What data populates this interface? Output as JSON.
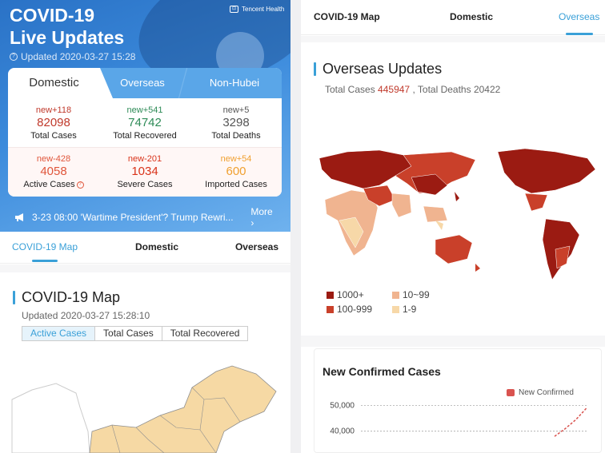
{
  "left": {
    "hero": {
      "title_line1": "COVID-19",
      "title_line2": "Live Updates",
      "brand": "Tencent Health",
      "updated": "Updated 2020-03-27 15:28"
    },
    "card": {
      "tabs": [
        "Domestic",
        "Overseas",
        "Non-Hubei"
      ],
      "stats": [
        {
          "new": "new+118",
          "value": "82098",
          "label": "Total Cases",
          "color": "#c0392b"
        },
        {
          "new": "new+541",
          "value": "74742",
          "label": "Total Recovered",
          "color": "#2e8b57"
        },
        {
          "new": "new+5",
          "value": "3298",
          "label": "Total Deaths",
          "color": "#555555"
        },
        {
          "new": "new-428",
          "value": "4058",
          "label": "Active Cases",
          "color": "#e0563b"
        },
        {
          "new": "new-201",
          "value": "1034",
          "label": "Severe Cases",
          "color": "#d9331a"
        },
        {
          "new": "new+54",
          "value": "600",
          "label": "Imported Cases",
          "color": "#f0a030"
        }
      ]
    },
    "ticker": {
      "text": "3-23 08:00 'Wartime President'? Trump Rewri...",
      "more": "More"
    },
    "nav": [
      "COVID-19 Map",
      "Domestic",
      "Overseas"
    ],
    "map_section": {
      "title": "COVID-19 Map",
      "updated": "Updated 2020-03-27 15:28:10",
      "filters": [
        "Active Cases",
        "Total Cases",
        "Total Recovered"
      ]
    }
  },
  "right": {
    "nav": [
      "COVID-19 Map",
      "Domestic",
      "Overseas"
    ],
    "overseas": {
      "title": "Overseas Updates",
      "totals_prefix": "Total Cases",
      "total_cases": "445947",
      "deaths_prefix": ", Total Deaths",
      "total_deaths": "20422"
    },
    "legend": [
      {
        "label": "1000+",
        "color": "#9b1b12"
      },
      {
        "label": "10~99",
        "color": "#f0b490"
      },
      {
        "label": "100-999",
        "color": "#c9402a"
      },
      {
        "label": "1-9",
        "color": "#f7d8a8"
      }
    ],
    "chart": {
      "title": "New Confirmed Cases",
      "legend_label": "New Confirmed"
    }
  },
  "chart_data": {
    "type": "line",
    "title": "New Confirmed Cases",
    "series": [
      {
        "name": "New Confirmed",
        "color": "#d9534f",
        "values": [
          38000,
          41000,
          44500,
          49000
        ]
      }
    ],
    "y_ticks": [
      "50,000",
      "40,000"
    ],
    "ylim": [
      30000,
      52000
    ]
  }
}
